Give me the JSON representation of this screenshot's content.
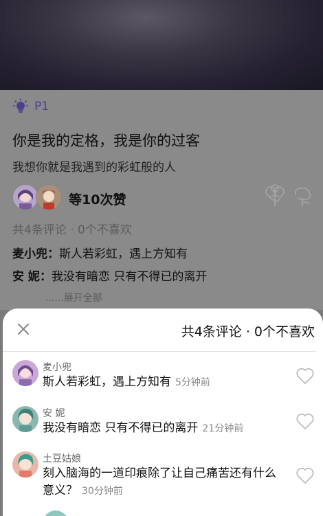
{
  "post": {
    "page_label": "P1",
    "title": "你是我的定格，我是你的过客",
    "subtitle": "我想你就是我遇到的彩虹般的人",
    "likes": "等10次赞",
    "summary": "共4条评论 · 0个不喜欢",
    "preview_comments": [
      {
        "author": "麦小兜：",
        "text": "斯人若彩虹，遇上方知有"
      },
      {
        "author": "安 妮：",
        "text": "我没有暗恋 只有不得已的离开"
      }
    ],
    "expand_label": "......展开全部"
  },
  "sheet": {
    "title": "共4条评论 · 0个不喜欢",
    "comments": [
      {
        "name": "麦小兜",
        "text": "斯人若彩虹，遇上方知有",
        "time": "5分钟前"
      },
      {
        "name": "安 妮",
        "text": "我没有暗恋 只有不得已的离开",
        "time": "21分钟前"
      },
      {
        "name": "土豆姑娘",
        "text": "刻入脑海的一道印痕除了让自己痛苦还有什么意义？",
        "time": "30分钟前"
      }
    ]
  },
  "colors": {
    "accent": "#4f3f8f",
    "overlay": "#7b7b7b",
    "sheet_bg": "#ffffff"
  },
  "icons": {
    "page_tag": "lightbulb-icon",
    "sheet_close": "close-icon",
    "comment_like": "heart-outline-icon",
    "post_actions": [
      "flower-icon",
      "flower-icon"
    ]
  }
}
